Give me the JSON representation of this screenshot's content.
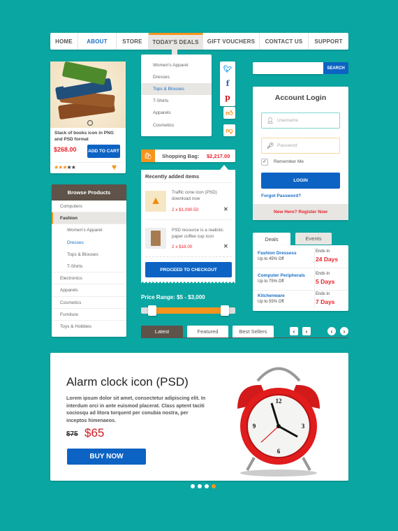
{
  "nav": {
    "items": [
      "HOME",
      "ABOUT",
      "STORE",
      "TODAY'S DEALS",
      "GIFT VOUCHERS",
      "CONTACT US",
      "SUPPORT"
    ]
  },
  "dropdown": {
    "items": [
      "Women's Apparel",
      "Dresses",
      "Tops & Blouses",
      "T-Shirts",
      "Apparels",
      "Cosmetics"
    ]
  },
  "product": {
    "title": "Stack of books icon in PNG and PSD format",
    "price": "$268.00",
    "add_to_cart": "ADD TO CART",
    "rating": 3,
    "rating_max": 5
  },
  "search": {
    "placeholder": "",
    "button": "SEARCH"
  },
  "login": {
    "title": "Account Login",
    "username_placeholder": "Username",
    "password_placeholder": "Password",
    "remember": "Remember Me",
    "remember_checked": true,
    "login_button": "LOGIN",
    "forgot": "Forgot Password?",
    "register": "New Here? Register Now"
  },
  "bag": {
    "label": "Shopping Bag:",
    "total": "$2,217.00",
    "header": "Recently added items",
    "items": [
      {
        "name": "Traffic cone icon (PSD) download now",
        "qty_price": "2 x $1,090.50"
      },
      {
        "name": "PSD resource is a realistic paper coffee cup icon",
        "qty_price": "2 x $18.00"
      }
    ],
    "checkout": "PROCEED TO CHECKOUT"
  },
  "price_range": {
    "label": "Price Range: $5 - $3,000",
    "min": 5,
    "max": 3000
  },
  "browse": {
    "title": "Browse Products",
    "items": [
      {
        "label": "Computers",
        "level": 0
      },
      {
        "label": "Fashion",
        "level": 0,
        "active": true
      },
      {
        "label": "Women's Apparel",
        "level": 1
      },
      {
        "label": "Dresses",
        "level": 1,
        "selected": true
      },
      {
        "label": "Tops & Blouses",
        "level": 1
      },
      {
        "label": "T-Shirts",
        "level": 1
      },
      {
        "label": "Electronics",
        "level": 0
      },
      {
        "label": "Apparels",
        "level": 0
      },
      {
        "label": "Cosmetics",
        "level": 0
      },
      {
        "label": "Furniture",
        "level": 0
      },
      {
        "label": "Toys & Hobbies",
        "level": 0
      }
    ]
  },
  "product_tabs": [
    "Latest",
    "Featured",
    "Best Sellers"
  ],
  "deals": {
    "tabs": [
      "Deals",
      "Events"
    ],
    "items": [
      {
        "name": "Fashion Dressess",
        "offer": "Up to 45% Off",
        "ends_label": "Ends in",
        "ends": "24 Days"
      },
      {
        "name": "Computer Peripherals",
        "offer": "Up to 75% Off",
        "ends_label": "Ends in",
        "ends": "5 Days"
      },
      {
        "name": "Kitchenware",
        "offer": "Up to 55% Off",
        "ends_label": "Ends in",
        "ends": "7 Days"
      }
    ]
  },
  "hero": {
    "title": "Alarm clock icon (PSD)",
    "body": "Lorem ipsum dolor sit amet, consectetur adipiscing elit. In interdum orci in ante euismod placerat. Class aptent taciti sociosqu ad litora torquent per conubia nostra, per inceptos himenaeos.",
    "old_price": "$75",
    "price": "$65",
    "button": "BUY NOW",
    "slides": 4,
    "active_slide": 4
  },
  "colors": {
    "background": "#0aa6a2",
    "primary": "#0d63c3",
    "accent": "#f7941d",
    "price": "#e8232a",
    "header": "#5e5249"
  }
}
